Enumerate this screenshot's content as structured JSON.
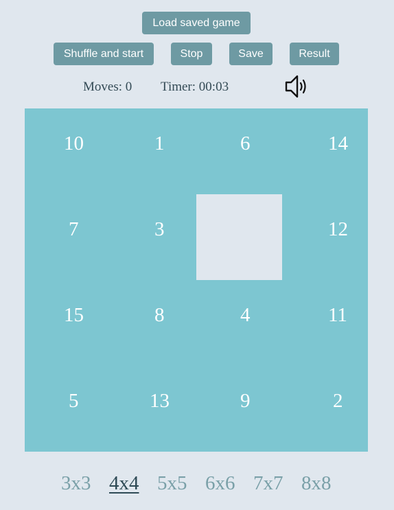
{
  "buttons": {
    "load": "Load saved game",
    "shuffle": "Shuffle and start",
    "stop": "Stop",
    "save": "Save",
    "result": "Result"
  },
  "stats": {
    "moves": "Moves: 0",
    "timer": "Timer: 00:03"
  },
  "sound_icon": "speaker-icon",
  "board": {
    "size": 4,
    "tiles": [
      "10",
      "1",
      "6",
      "14",
      "7",
      "3",
      "",
      "12",
      "15",
      "8",
      "4",
      "11",
      "5",
      "13",
      "9",
      "2"
    ]
  },
  "colors": {
    "background": "#e0e7ee",
    "board": "#7dc6d1",
    "button": "#6e9aa3",
    "tile_text": "#ffffff"
  },
  "sizes": {
    "options": [
      "3x3",
      "4x4",
      "5x5",
      "6x6",
      "7x7",
      "8x8"
    ],
    "selected": "4x4"
  }
}
